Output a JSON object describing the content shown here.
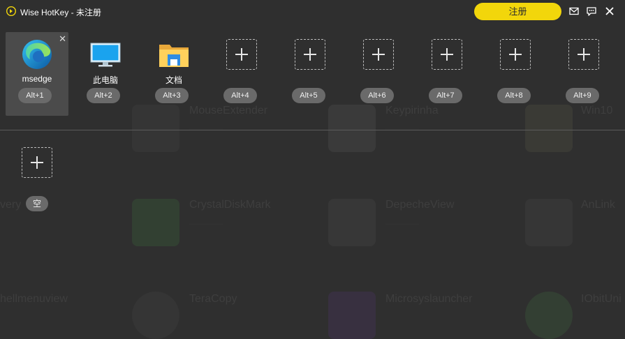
{
  "window": {
    "title": "Wise HotKey - 未注册"
  },
  "titlebar": {
    "register_label": "注册",
    "icons": [
      "mail-icon",
      "feedback-icon",
      "close-icon"
    ]
  },
  "slots": [
    {
      "label": "msedge",
      "key": "Alt+1",
      "icon": "edge-icon",
      "selected": true
    },
    {
      "label": "此电脑",
      "key": "Alt+2",
      "icon": "this-pc-icon"
    },
    {
      "label": "文档",
      "key": "Alt+3",
      "icon": "documents-folder-icon"
    },
    {
      "label": "",
      "key": "Alt+4",
      "icon": "add-icon"
    },
    {
      "label": "",
      "key": "Alt+5",
      "icon": "add-icon"
    },
    {
      "label": "",
      "key": "Alt+6",
      "icon": "add-icon"
    },
    {
      "label": "",
      "key": "Alt+7",
      "icon": "add-icon"
    },
    {
      "label": "",
      "key": "Alt+8",
      "icon": "add-icon"
    },
    {
      "label": "",
      "key": "Alt+9",
      "icon": "add-icon"
    }
  ],
  "extra_slot": {
    "key": "空",
    "icon": "add-icon"
  },
  "background_apps": [
    {
      "name": "MouseExtender"
    },
    {
      "name": "Keypirinha"
    },
    {
      "name": "Win10"
    },
    {
      "name": "very"
    },
    {
      "name": "CrystalDiskMark"
    },
    {
      "name": "DepecheView"
    },
    {
      "name": "AnLink"
    },
    {
      "name": "hellmenuview"
    },
    {
      "name": "TeraCopy"
    },
    {
      "name": "Microsyslauncher"
    },
    {
      "name": "IObitUni"
    }
  ]
}
